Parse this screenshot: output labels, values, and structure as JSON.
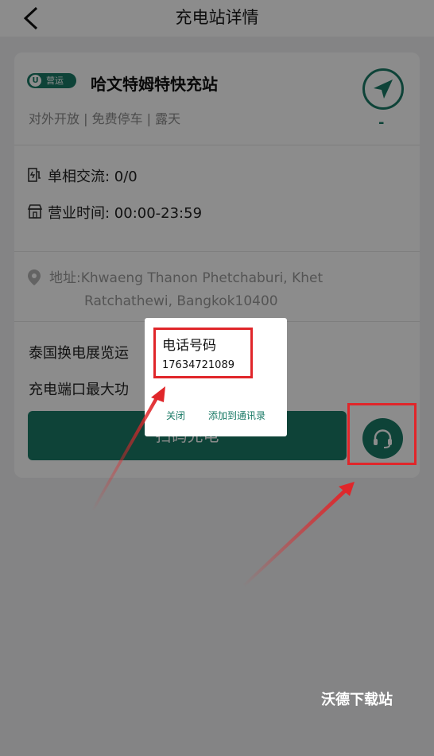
{
  "header": {
    "title": "充电站详情"
  },
  "station": {
    "status_badge": "营运",
    "badge_letter": "U",
    "name": "哈文特姆特快充站",
    "tags": "对外开放 | 免费停车 | 露天",
    "distance": "-"
  },
  "info": {
    "charger_type": "单相交流: 0/0",
    "hours": "营业时间:   00:00-23:59"
  },
  "address": {
    "line1": "地址:Khwaeng Thanon Phetchaburi, Khet",
    "line2": "Ratchathewi, Bangkok10400"
  },
  "notes": {
    "line1": "泰国换电展览运",
    "line2": "充电端口最大功"
  },
  "actions": {
    "scan_label": "扫码充电"
  },
  "dialog": {
    "title": "电话号码",
    "phone": "17634721089",
    "close_label": "关闭",
    "add_label": "添加到通讯录"
  },
  "watermark": "沃德下载站",
  "colors": {
    "accent": "#1a7a66",
    "highlight": "#e0262a"
  }
}
